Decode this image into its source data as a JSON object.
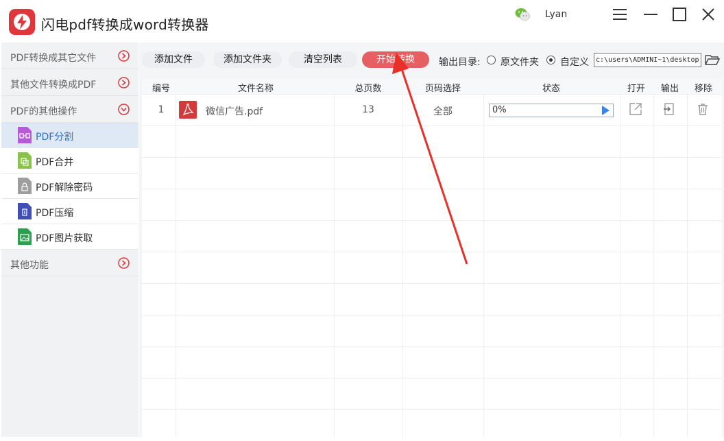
{
  "app": {
    "title": "闪电pdf转换成word转换器",
    "username": "Lyan",
    "brand_color": "#e0373d"
  },
  "sidebar": {
    "categories": [
      {
        "label": "PDF转换成其它文件",
        "state": "collapsed"
      },
      {
        "label": "其他文件转换成PDF",
        "state": "collapsed"
      },
      {
        "label": "PDF的其他操作",
        "state": "expanded"
      }
    ],
    "items": [
      {
        "label": "PDF分割",
        "icon": "split-icon",
        "color": "#b65ad6",
        "active": true
      },
      {
        "label": "PDF合并",
        "icon": "merge-icon",
        "color": "#8bc34a",
        "active": false
      },
      {
        "label": "PDF解除密码",
        "icon": "unlock-icon",
        "color": "#9e9e9e",
        "active": false
      },
      {
        "label": "PDF压缩",
        "icon": "compress-icon",
        "color": "#3f4fb5",
        "active": false
      },
      {
        "label": "PDF图片获取",
        "icon": "image-icon",
        "color": "#2e9e4f",
        "active": false
      }
    ],
    "other": {
      "label": "其他功能",
      "state": "collapsed"
    }
  },
  "toolbar": {
    "add_file": "添加文件",
    "add_folder": "添加文件夹",
    "clear_list": "清空列表",
    "start": "开始转换",
    "output_label": "输出目录:",
    "option_original": "原文件夹",
    "option_custom": "自定义",
    "selected_option": "custom",
    "path": "c:\\users\\ADMINI~1\\desktop",
    "accent_color": "#e65f63"
  },
  "table": {
    "headers": [
      "编号",
      "文件名称",
      "总页数",
      "页码选择",
      "状态",
      "打开",
      "输出",
      "移除"
    ],
    "rows": [
      {
        "index": "1",
        "filename": "微信广告.pdf",
        "pages": "13",
        "page_select": "全部",
        "status": "0%"
      }
    ]
  },
  "annotation": {
    "arrow_color": "#e8302a"
  }
}
